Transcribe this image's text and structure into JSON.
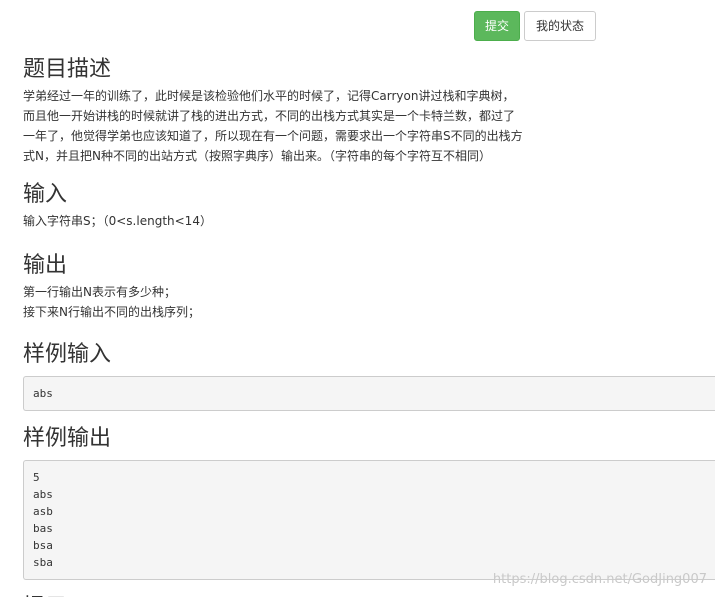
{
  "toolbar": {
    "submit_label": "提交",
    "status_label": "我的状态"
  },
  "problem": {
    "description_title": "题目描述",
    "description_text": "学弟经过一年的训练了，此时候是该检验他们水平的时候了，记得Carryon讲过栈和字典树，\n而且他一开始讲栈的时候就讲了栈的进出方式，不同的出栈方式其实是一个卡特兰数，都过了\n一年了，他觉得学弟也应该知道了，所以现在有一个问题，需要求出一个字符串S不同的出栈方\n式N，并且把N种不同的出站方式（按照字典序）输出来。（字符串的每个字符互不相同）",
    "input_title": "输入",
    "input_text": "输入字符串S；（0<s.length<14）",
    "output_title": "输出",
    "output_text": "第一行输出N表示有多少种；\n接下来N行输出不同的出栈序列；",
    "sample_input_title": "样例输入",
    "sample_input": "abs",
    "sample_output_title": "样例输出",
    "sample_output": "5\nabs\nasb\nbas\nbsa\nsba",
    "hint_title": "提示"
  },
  "watermark": "https://blog.csdn.net/GodJing007"
}
